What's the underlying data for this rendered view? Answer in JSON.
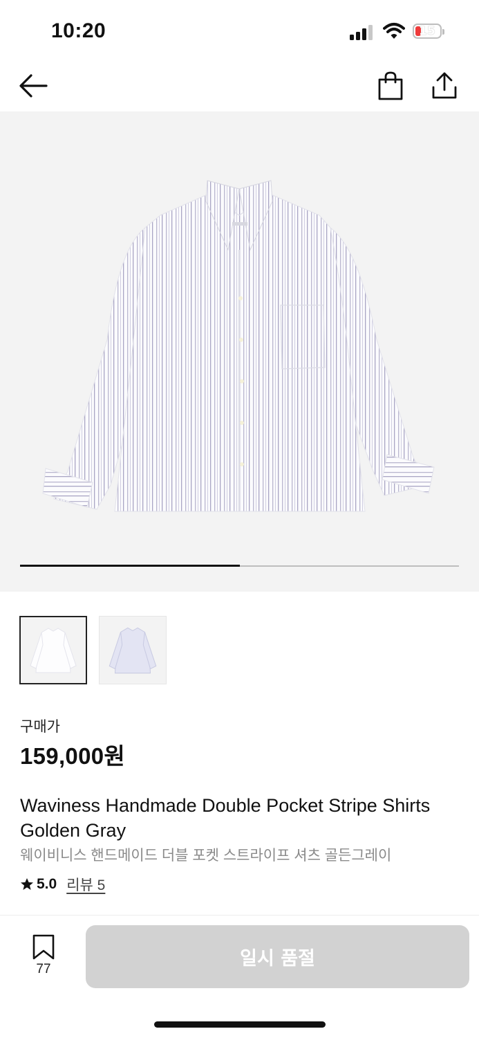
{
  "status_bar": {
    "time": "10:20",
    "battery": "15"
  },
  "navbar": {
    "back_icon": "arrow-left-icon",
    "cart_icon": "shopping-bag-icon",
    "share_icon": "share-icon"
  },
  "gallery": {
    "current_index": 1,
    "total": 2,
    "progress_fraction": 0.5,
    "thumbnails": [
      "shirt-white-stripe",
      "shirt-blue-stripe"
    ]
  },
  "price": {
    "label": "구매가",
    "value": "159,000원"
  },
  "product": {
    "title_en": "Waviness Handmade Double Pocket Stripe Shirts Golden Gray",
    "title_ko": "웨이비니스 핸드메이드 더블 포켓 스트라이프 셔츠 골든그레이"
  },
  "rating": {
    "score": "5.0",
    "reviews": "리뷰 5"
  },
  "footer": {
    "bookmark_count": "77",
    "buy_label": "일시 품절"
  },
  "colors": {
    "button_disabled": "#d2d2d2",
    "accent": "#111111",
    "battery_low": "#ef3b3b"
  }
}
